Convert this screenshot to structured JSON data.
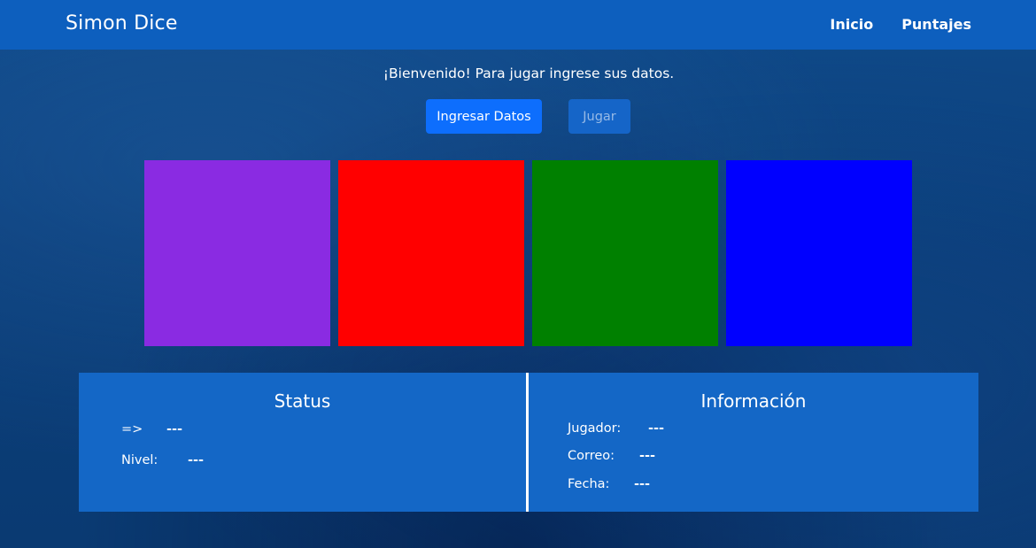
{
  "header": {
    "brand": "Simon Dice",
    "nav": [
      {
        "label": "Inicio"
      },
      {
        "label": "Puntajes"
      }
    ]
  },
  "welcome": "¡Bienvenido! Para jugar ingrese sus datos.",
  "buttons": {
    "enter_data": "Ingresar Datos",
    "play": "Jugar",
    "play_disabled": true
  },
  "pads": [
    {
      "color_name": "purple",
      "color": "#8a2be2"
    },
    {
      "color_name": "red",
      "color": "#ff0000"
    },
    {
      "color_name": "green",
      "color": "#008000"
    },
    {
      "color_name": "blue",
      "color": "#0000ff"
    }
  ],
  "status": {
    "title": "Status",
    "arrow_label": "=>",
    "arrow_value": "---",
    "level_label": "Nivel:",
    "level_value": "---"
  },
  "info": {
    "title": "Información",
    "player_label": "Jugador:",
    "player_value": "---",
    "email_label": "Correo:",
    "email_value": "---",
    "date_label": "Fecha:",
    "date_value": "---"
  },
  "colors": {
    "navbar": "#0d5fbe",
    "panel": "#1467c6",
    "primary_button": "#0d6efd"
  }
}
